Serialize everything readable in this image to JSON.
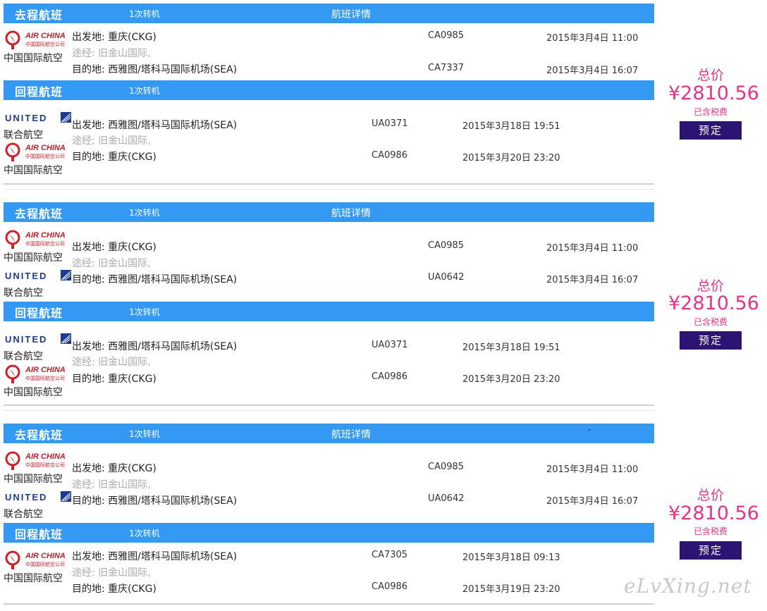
{
  "labels": {
    "outbound": "去程航班",
    "return": "回程航班",
    "flight_details": "航班详情",
    "total": "总价",
    "tax_included": "已含税费",
    "book": "预定"
  },
  "airlines": {
    "air_china": {
      "logo_text": "AIR CHINA",
      "name": "中国国际航空"
    },
    "united": {
      "logo_text": "UNITED",
      "name": "联合航空"
    }
  },
  "options": [
    {
      "price": "¥2810.56",
      "outbound": {
        "transfer": "1次转机",
        "depart": "出发地: 重庆(CKG)",
        "via": "途经: 旧金山国际,",
        "arrive": "目的地: 西雅图/塔科马国际机场(SEA)",
        "flight1": "CA0985",
        "time1": "2015年3月4日  11:00",
        "flight2": "CA7337",
        "time2": "2015年3月4日  16:07"
      },
      "return": {
        "transfer": "1次转机",
        "depart": "出发地: 西雅图/塔科马国际机场(SEA)",
        "via": "途经: 旧金山国际,",
        "arrive": "目的地: 重庆(CKG)",
        "flight1": "UA0371",
        "time1": "2015年3月18日  19:51",
        "flight2": "CA0986",
        "time2": "2015年3月20日  23:20"
      }
    },
    {
      "price": "¥2810.56",
      "outbound": {
        "transfer": "1次转机",
        "depart": "出发地: 重庆(CKG)",
        "via": "途经: 旧金山国际,",
        "arrive": "目的地: 西雅图/塔科马国际机场(SEA)",
        "flight1": "CA0985",
        "time1": "2015年3月4日  11:00",
        "flight2": "UA0642",
        "time2": "2015年3月4日  16:07"
      },
      "return": {
        "transfer": "1次转机",
        "depart": "出发地: 西雅图/塔科马国际机场(SEA)",
        "via": "途经: 旧金山国际,",
        "arrive": "目的地: 重庆(CKG)",
        "flight1": "UA0371",
        "time1": "2015年3月18日  19:51",
        "flight2": "CA0986",
        "time2": "2015年3月20日  23:20"
      }
    },
    {
      "price": "¥2810.56",
      "outbound": {
        "transfer": "1次转机",
        "depart": "出发地: 重庆(CKG)",
        "via": "途经: 旧金山国际,",
        "arrive": "目的地: 西雅图/塔科马国际机场(SEA)",
        "flight1": "CA0985",
        "time1": "2015年3月4日  11:00",
        "flight2": "UA0642",
        "time2": "2015年3月4日  16:07"
      },
      "return": {
        "transfer": "1次转机",
        "depart": "出发地: 西雅图/塔科马国际机场(SEA)",
        "via": "途经: 旧金山国际,",
        "arrive": "目的地: 重庆(CKG)",
        "flight1": "CA7305",
        "time1": "2015年3月18日  09:13",
        "flight2": "CA0986",
        "time2": "2015年3月19日  23:20"
      }
    }
  ],
  "watermark": "eLvXing.net",
  "colors": {
    "bar": "#3399f3",
    "price": "#e0368a",
    "button": "#2c1473"
  }
}
